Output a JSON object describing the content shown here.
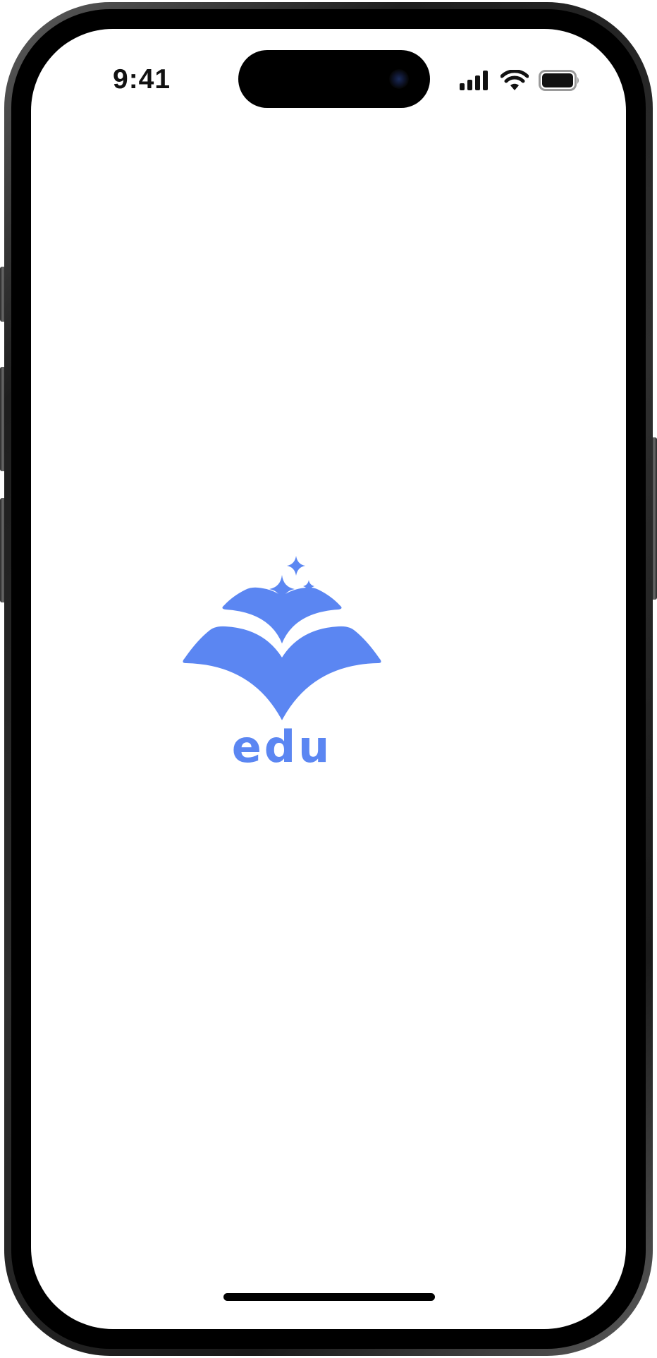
{
  "status_bar": {
    "time": "9:41",
    "icons": [
      "cellular-signal-icon",
      "wifi-icon",
      "battery-icon"
    ]
  },
  "logo": {
    "text": "edu",
    "icon": "open-book-sparkles-icon",
    "color": "#5b86f2"
  }
}
